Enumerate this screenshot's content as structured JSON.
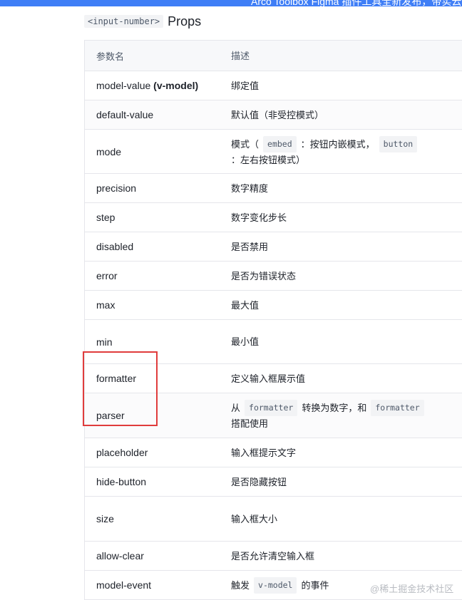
{
  "banner": {
    "text": "Arco Toolbox Figma 插件工具全新发布，带实云模"
  },
  "section": {
    "code": "<input-number>",
    "title": "Props"
  },
  "table": {
    "headers": {
      "name": "参数名",
      "desc": "描述"
    },
    "rows": [
      {
        "name": "model-value",
        "name_suffix": "(v-model)",
        "desc": "绑定值"
      },
      {
        "name": "default-value",
        "desc": "默认值（非受控模式）"
      },
      {
        "name": "mode",
        "desc_parts": [
          "模式（",
          "embed",
          "：按钮内嵌模式，",
          "button",
          "：左右按钮模式）"
        ]
      },
      {
        "name": "precision",
        "desc": "数字精度"
      },
      {
        "name": "step",
        "desc": "数字变化步长"
      },
      {
        "name": "disabled",
        "desc": "是否禁用"
      },
      {
        "name": "error",
        "desc": "是否为错误状态"
      },
      {
        "name": "max",
        "desc": "最大值"
      },
      {
        "name": "min",
        "desc": "最小值"
      },
      {
        "name": "formatter",
        "desc": "定义输入框展示值"
      },
      {
        "name": "parser",
        "desc_parts": [
          "从",
          "formatter",
          "转换为数字，和",
          "formatter",
          "搭配使用"
        ]
      },
      {
        "name": "placeholder",
        "desc": "输入框提示文字"
      },
      {
        "name": "hide-button",
        "desc": "是否隐藏按钮"
      },
      {
        "name": "size",
        "desc": "输入框大小"
      },
      {
        "name": "allow-clear",
        "desc": "是否允许清空输入框"
      },
      {
        "name": "model-event",
        "desc_parts": [
          "触发",
          "v-model",
          "的事件"
        ]
      }
    ]
  },
  "highlight": {
    "color": "#e03c3c"
  },
  "watermark": {
    "text": "@稀土掘金技术社区"
  }
}
